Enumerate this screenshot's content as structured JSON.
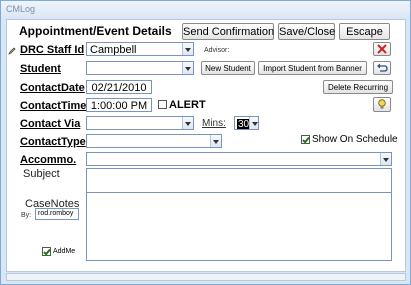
{
  "window": {
    "title": "CMLog"
  },
  "header": {
    "title": "Appointment/Event Details",
    "send_confirmation": "Send Confirmation",
    "save_close": "Save/Close",
    "escape": "Escape"
  },
  "form": {
    "staff_label": "DRC Staff Id",
    "staff_value": "Campbell",
    "advisor_label": "Advisor:",
    "student_label": "Student",
    "student_value": "",
    "new_student": "New Student",
    "import_student": "Import Student from Banner",
    "date_label": "ContactDate",
    "date_value": "02/21/2010",
    "delete_recurring": "Delete Recurring",
    "time_label": "ContactTime",
    "time_value": "1:00:00 PM",
    "alert_label": "ALERT",
    "via_label": "Contact Via",
    "via_value": "",
    "mins_label": "Mins:",
    "mins_value": "30",
    "type_label": "ContactType",
    "type_value": "",
    "show_schedule_label": "Show On Schedule",
    "accommo_label": "Accommo.",
    "accommo_value": "",
    "subject_label": "Subject",
    "subject_value": "",
    "casenotes_label": "CaseNotes",
    "by_label": "By:",
    "by_value": "rod.romboy",
    "addme_label": "AddMe",
    "casenotes_value": ""
  },
  "state": {
    "alert_checked": false,
    "show_on_schedule_checked": true,
    "addme_checked": true
  },
  "colors": {
    "window_bg": "#d9e6f5",
    "border": "#7fa9d6",
    "checkmark": "#1a7a1a"
  },
  "icons": {
    "delete_icon": "red-x-icon",
    "undo_icon": "undo-arrow-icon",
    "help_icon": "lightbulb-icon",
    "edit_icon": "pencil-icon"
  }
}
